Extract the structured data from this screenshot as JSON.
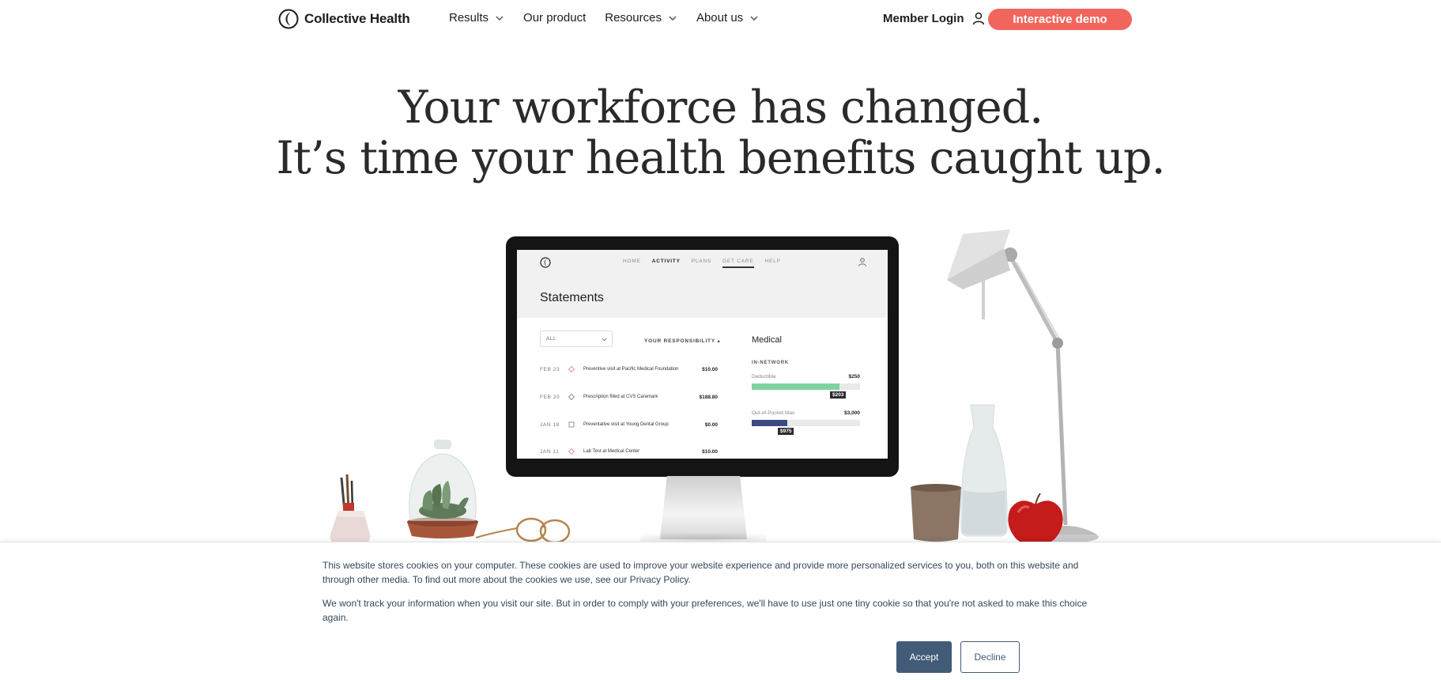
{
  "header": {
    "brand": "Collective Health",
    "nav": [
      {
        "label": "Results"
      },
      {
        "label": "Our product"
      },
      {
        "label": "Resources"
      },
      {
        "label": "About us"
      }
    ],
    "member_login": "Member Login",
    "cta": "Interactive demo",
    "colors": {
      "cta": "#f2655c",
      "text": "#1d1d1d"
    }
  },
  "hero": {
    "line1": "Your workforce has changed.",
    "line2": "It’s time your health benefits caught up."
  },
  "device_screen": {
    "nav": [
      "HOME",
      "ACTIVITY",
      "PLANS",
      "GET CARE",
      "HELP"
    ],
    "title": "Statements",
    "filter": "ALL",
    "column_header": "YOUR RESPONSIBILITY ▴",
    "statements": [
      {
        "date": "FEB 23",
        "desc": "Preventive visit at Pacific Medical Foundation",
        "amount": "$10.00"
      },
      {
        "date": "FEB 20",
        "desc": "Prescription filled at CVS Caremark",
        "amount": "$188.80"
      },
      {
        "date": "JAN 18",
        "desc": "Preventative visit at Young Dental Group",
        "amount": "$0.00"
      },
      {
        "date": "JAN 11",
        "desc": "Lab Test at Medical Center",
        "amount": "$10.00"
      }
    ],
    "medical": {
      "title": "Medical",
      "network": "IN-NETWORK",
      "deductible": {
        "label": "Deductible",
        "max": "$250",
        "value": "$203",
        "fraction": 0.81,
        "color": "#7dd3a0"
      },
      "oop": {
        "label": "Out-of-Pocket Max",
        "max": "$3,000",
        "value": "$975",
        "fraction": 0.33,
        "color": "#3b4a86"
      }
    }
  },
  "cookie": {
    "p1": "This website stores cookies on your computer. These cookies are used to improve your website experience and provide more personalized services to you, both on this website and through other media. To find out more about the cookies we use, see our Privacy Policy.",
    "p2": "We won't track your information when you visit our site. But in order to comply with your preferences, we'll have to use just one tiny cookie so that you're not asked to make this choice again.",
    "accept": "Accept",
    "decline": "Decline",
    "colors": {
      "button": "#425b76",
      "text": "#33475b"
    }
  }
}
